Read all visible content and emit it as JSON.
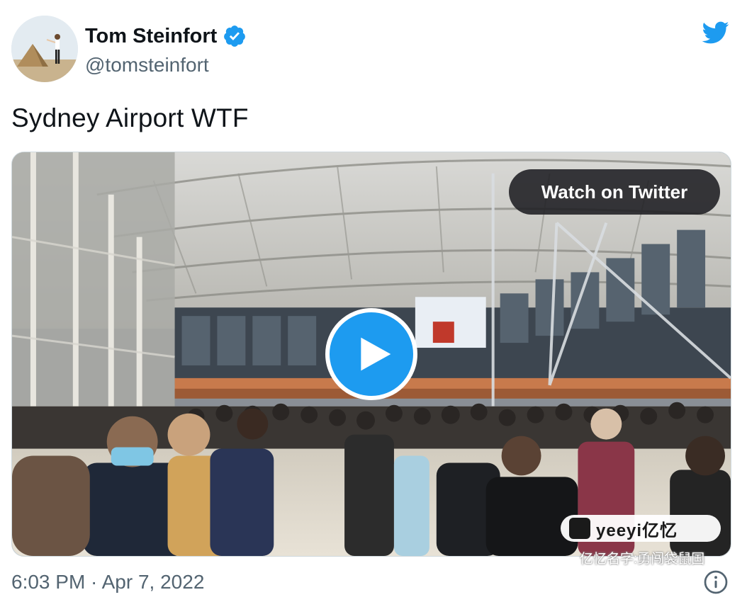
{
  "author": {
    "display_name": "Tom Steinfort",
    "handle": "@tomsteinfort",
    "verified": true,
    "avatar_icon": "avatar-pyramids-photo"
  },
  "tweet": {
    "text": "Sydney Airport WTF",
    "timestamp": "6:03 PM · Apr 7, 2022"
  },
  "media": {
    "type": "video",
    "watch_label": "Watch on Twitter",
    "play_icon": "play-icon",
    "watermark_badge": "yeeyi亿忆",
    "watermark_caption": "亿忆名字:勇闯袋鼠国"
  },
  "icons": {
    "brand": "twitter-bird-icon",
    "verified": "verified-badge-icon",
    "info": "info-icon"
  },
  "colors": {
    "twitter_blue": "#1d9bf0",
    "text_primary": "#0f1419",
    "text_secondary": "#536471"
  }
}
